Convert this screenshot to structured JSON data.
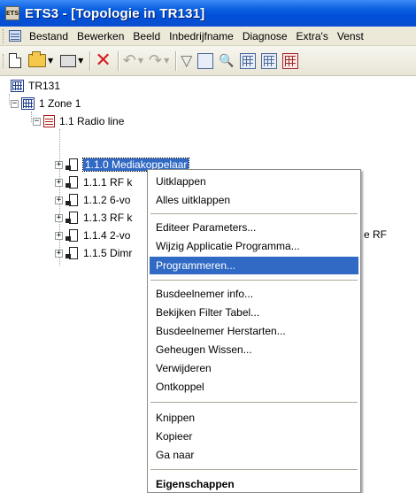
{
  "window": {
    "app_icon_text": "ETS",
    "title": "ETS3 - [Topologie in TR131]"
  },
  "menubar": {
    "items": [
      "Bestand",
      "Bewerken",
      "Beeld",
      "Inbedrijfname",
      "Diagnose",
      "Extra's",
      "Venst"
    ]
  },
  "toolbar": {
    "buttons": [
      "new-icon",
      "open-icon",
      "print-icon",
      "delete-icon",
      "undo-icon",
      "redo-icon",
      "filter-icon",
      "refresh-icon",
      "key-icon",
      "device-icon",
      "topology-icon",
      "group-icon"
    ]
  },
  "tree": {
    "root": "TR131",
    "zone": "1 Zone 1",
    "line": "1.1 Radio line",
    "devices": [
      {
        "label": "1.1.0 Mediakoppelaar",
        "selected": true
      },
      {
        "label": "1.1.1 RF k"
      },
      {
        "label": "1.1.2 6-vo"
      },
      {
        "label": "1.1.3 RF k"
      },
      {
        "label": "1.1.4 2-vo"
      },
      {
        "label": "1.1.5 Dimr"
      }
    ],
    "truncated_suffix": "e RF"
  },
  "context_menu": {
    "groups": [
      [
        "Uitklappen",
        "Alles uitklappen"
      ],
      [
        "Editeer Parameters...",
        "Wijzig Applicatie Programma...",
        "Programmeren..."
      ],
      [
        "Busdeelnemer info...",
        "Bekijken Filter Tabel...",
        "Busdeelnemer Herstarten...",
        "Geheugen Wissen...",
        "Verwijderen",
        "Ontkoppel"
      ],
      [
        "Knippen",
        "Kopieer",
        "Ga naar"
      ],
      [
        "Eigenschappen"
      ]
    ],
    "highlighted": "Programmeren...",
    "highlight_color": "#316ac5"
  }
}
